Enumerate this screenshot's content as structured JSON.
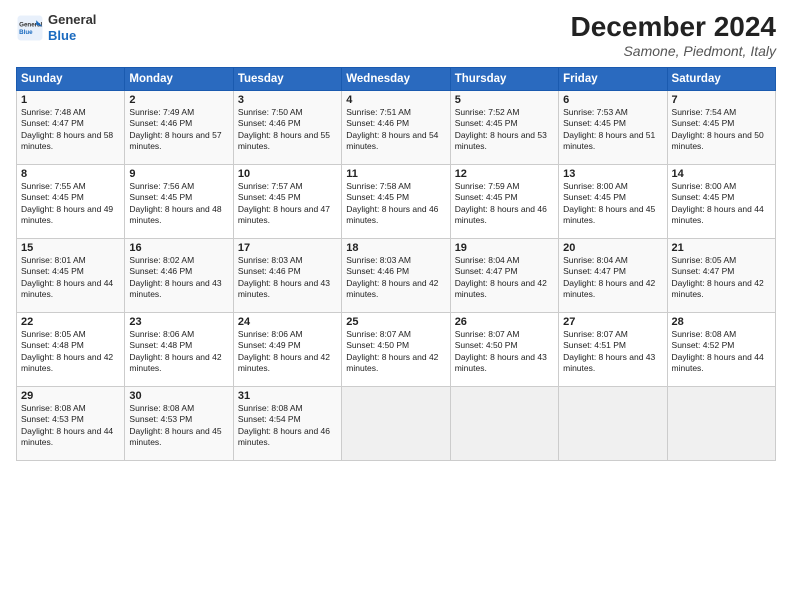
{
  "header": {
    "logo_general": "General",
    "logo_blue": "Blue",
    "month_title": "December 2024",
    "subtitle": "Samone, Piedmont, Italy"
  },
  "days_of_week": [
    "Sunday",
    "Monday",
    "Tuesday",
    "Wednesday",
    "Thursday",
    "Friday",
    "Saturday"
  ],
  "weeks": [
    [
      {
        "day": 1,
        "sunrise": "7:48 AM",
        "sunset": "4:47 PM",
        "daylight": "8 hours and 58 minutes."
      },
      {
        "day": 2,
        "sunrise": "7:49 AM",
        "sunset": "4:46 PM",
        "daylight": "8 hours and 57 minutes."
      },
      {
        "day": 3,
        "sunrise": "7:50 AM",
        "sunset": "4:46 PM",
        "daylight": "8 hours and 55 minutes."
      },
      {
        "day": 4,
        "sunrise": "7:51 AM",
        "sunset": "4:46 PM",
        "daylight": "8 hours and 54 minutes."
      },
      {
        "day": 5,
        "sunrise": "7:52 AM",
        "sunset": "4:45 PM",
        "daylight": "8 hours and 53 minutes."
      },
      {
        "day": 6,
        "sunrise": "7:53 AM",
        "sunset": "4:45 PM",
        "daylight": "8 hours and 51 minutes."
      },
      {
        "day": 7,
        "sunrise": "7:54 AM",
        "sunset": "4:45 PM",
        "daylight": "8 hours and 50 minutes."
      }
    ],
    [
      {
        "day": 8,
        "sunrise": "7:55 AM",
        "sunset": "4:45 PM",
        "daylight": "8 hours and 49 minutes."
      },
      {
        "day": 9,
        "sunrise": "7:56 AM",
        "sunset": "4:45 PM",
        "daylight": "8 hours and 48 minutes."
      },
      {
        "day": 10,
        "sunrise": "7:57 AM",
        "sunset": "4:45 PM",
        "daylight": "8 hours and 47 minutes."
      },
      {
        "day": 11,
        "sunrise": "7:58 AM",
        "sunset": "4:45 PM",
        "daylight": "8 hours and 46 minutes."
      },
      {
        "day": 12,
        "sunrise": "7:59 AM",
        "sunset": "4:45 PM",
        "daylight": "8 hours and 46 minutes."
      },
      {
        "day": 13,
        "sunrise": "8:00 AM",
        "sunset": "4:45 PM",
        "daylight": "8 hours and 45 minutes."
      },
      {
        "day": 14,
        "sunrise": "8:00 AM",
        "sunset": "4:45 PM",
        "daylight": "8 hours and 44 minutes."
      }
    ],
    [
      {
        "day": 15,
        "sunrise": "8:01 AM",
        "sunset": "4:45 PM",
        "daylight": "8 hours and 44 minutes."
      },
      {
        "day": 16,
        "sunrise": "8:02 AM",
        "sunset": "4:46 PM",
        "daylight": "8 hours and 43 minutes."
      },
      {
        "day": 17,
        "sunrise": "8:03 AM",
        "sunset": "4:46 PM",
        "daylight": "8 hours and 43 minutes."
      },
      {
        "day": 18,
        "sunrise": "8:03 AM",
        "sunset": "4:46 PM",
        "daylight": "8 hours and 42 minutes."
      },
      {
        "day": 19,
        "sunrise": "8:04 AM",
        "sunset": "4:47 PM",
        "daylight": "8 hours and 42 minutes."
      },
      {
        "day": 20,
        "sunrise": "8:04 AM",
        "sunset": "4:47 PM",
        "daylight": "8 hours and 42 minutes."
      },
      {
        "day": 21,
        "sunrise": "8:05 AM",
        "sunset": "4:47 PM",
        "daylight": "8 hours and 42 minutes."
      }
    ],
    [
      {
        "day": 22,
        "sunrise": "8:05 AM",
        "sunset": "4:48 PM",
        "daylight": "8 hours and 42 minutes."
      },
      {
        "day": 23,
        "sunrise": "8:06 AM",
        "sunset": "4:48 PM",
        "daylight": "8 hours and 42 minutes."
      },
      {
        "day": 24,
        "sunrise": "8:06 AM",
        "sunset": "4:49 PM",
        "daylight": "8 hours and 42 minutes."
      },
      {
        "day": 25,
        "sunrise": "8:07 AM",
        "sunset": "4:50 PM",
        "daylight": "8 hours and 42 minutes."
      },
      {
        "day": 26,
        "sunrise": "8:07 AM",
        "sunset": "4:50 PM",
        "daylight": "8 hours and 43 minutes."
      },
      {
        "day": 27,
        "sunrise": "8:07 AM",
        "sunset": "4:51 PM",
        "daylight": "8 hours and 43 minutes."
      },
      {
        "day": 28,
        "sunrise": "8:08 AM",
        "sunset": "4:52 PM",
        "daylight": "8 hours and 44 minutes."
      }
    ],
    [
      {
        "day": 29,
        "sunrise": "8:08 AM",
        "sunset": "4:53 PM",
        "daylight": "8 hours and 44 minutes."
      },
      {
        "day": 30,
        "sunrise": "8:08 AM",
        "sunset": "4:53 PM",
        "daylight": "8 hours and 45 minutes."
      },
      {
        "day": 31,
        "sunrise": "8:08 AM",
        "sunset": "4:54 PM",
        "daylight": "8 hours and 46 minutes."
      },
      null,
      null,
      null,
      null
    ]
  ],
  "labels": {
    "sunrise": "Sunrise:",
    "sunset": "Sunset:",
    "daylight": "Daylight:"
  }
}
